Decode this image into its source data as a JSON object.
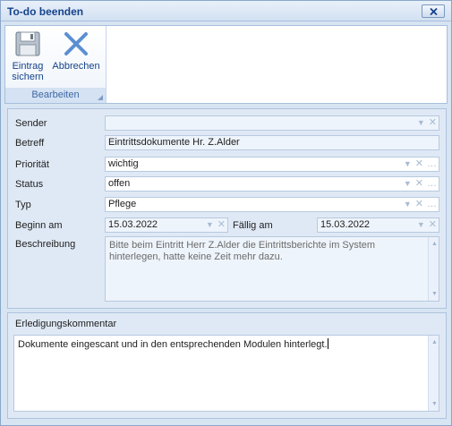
{
  "window": {
    "title": "To-do beenden"
  },
  "ribbon": {
    "save_label_line1": "Eintrag",
    "save_label_line2": "sichern",
    "cancel_label": "Abbrechen",
    "group_label": "Bearbeiten"
  },
  "form": {
    "sender": {
      "label": "Sender",
      "value": ""
    },
    "subject": {
      "label": "Betreff",
      "value": "Eintrittsdokumente Hr. Z.Alder"
    },
    "priority": {
      "label": "Priorität",
      "value": "wichtig"
    },
    "status": {
      "label": "Status",
      "value": "offen"
    },
    "type": {
      "label": "Typ",
      "value": "Pflege"
    },
    "start": {
      "label": "Beginn am",
      "value": "15.03.2022"
    },
    "due": {
      "label": "Fällig am",
      "value": "15.03.2022"
    },
    "description": {
      "label": "Beschreibung",
      "value": "Bitte beim Eintritt Herr Z.Alder die Eintrittsberichte im System hinterlegen, hatte keine Zeit mehr dazu."
    }
  },
  "completion": {
    "label": "Erledigungskommentar",
    "value": "Dokumente eingescant und in den entsprechenden Modulen hinterlegt."
  },
  "icons": {
    "save": "floppy-disk-icon",
    "cancel": "x-icon",
    "dropdown": "chevron-down-icon",
    "clear": "clear-x-icon",
    "ellipsis": "ellipsis-icon"
  },
  "colors": {
    "title_text": "#15428b",
    "accent": "#3f68a3"
  }
}
